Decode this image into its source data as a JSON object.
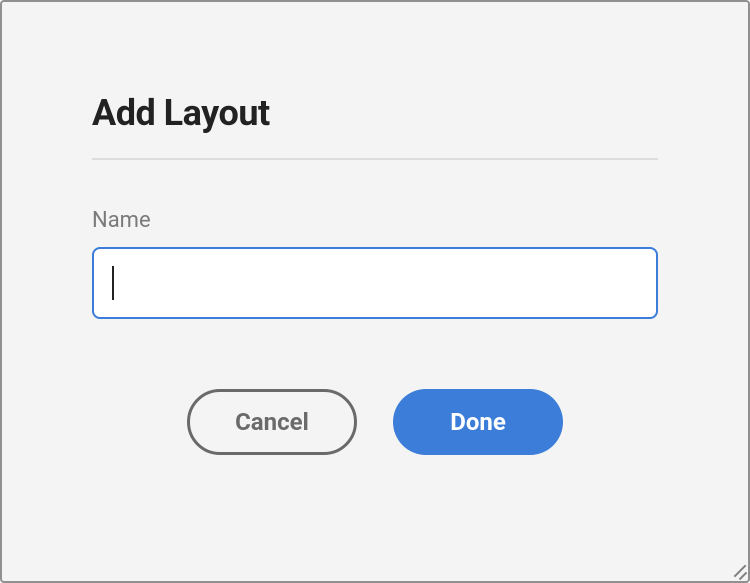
{
  "dialog": {
    "title": "Add Layout",
    "field_label": "Name",
    "input_value": "",
    "input_placeholder": "",
    "cancel_label": "Cancel",
    "done_label": "Done"
  }
}
